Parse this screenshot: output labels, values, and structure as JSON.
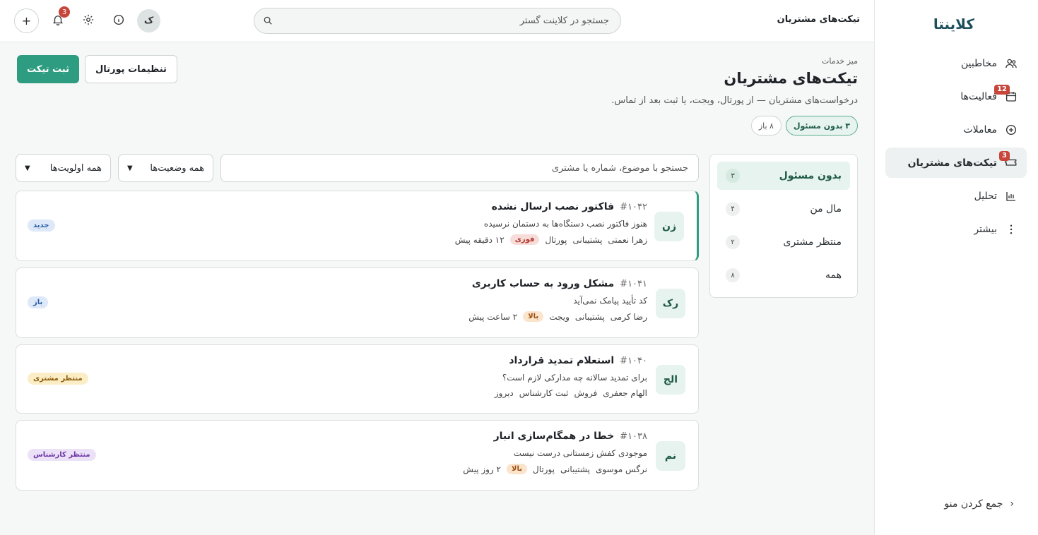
{
  "sidebar": {
    "brand": "کلاینتا",
    "items": [
      {
        "label": "مخاطبین",
        "icon": "users-icon",
        "badge": ""
      },
      {
        "label": "فعالیت‌ها",
        "icon": "calendar-icon",
        "badge": "12"
      },
      {
        "label": "معاملات",
        "icon": "plus-circle-icon",
        "badge": ""
      },
      {
        "label": "تیکت‌های مشتریان",
        "icon": "ticket-icon",
        "badge": "3"
      },
      {
        "label": "تحلیل",
        "icon": "chart-icon",
        "badge": ""
      },
      {
        "label": "بیشتر",
        "icon": "more-vertical-icon",
        "badge": ""
      }
    ],
    "collapse_label": "جمع کردن منو"
  },
  "topbar": {
    "title": "تیکت‌های مشتریان",
    "search_placeholder": "جستجو در کلاینت گستر",
    "notification_count": "3",
    "avatar_initial": "ک"
  },
  "page": {
    "breadcrumb": "میز خدمات",
    "title": "تیکت‌های مشتریان",
    "subtitle": "درخواست‌های مشتریان — از پورتال، ویجت، یا ثبت بعد از تماس.",
    "chip_unassigned": "۳ بدون مسئول",
    "chip_open": "۸ باز",
    "btn_new_ticket": "ثبت تیکت",
    "btn_portal_settings": "تنظیمات پورتال"
  },
  "views": [
    {
      "label": "بدون مسئول",
      "count": "۳"
    },
    {
      "label": "مال من",
      "count": "۴"
    },
    {
      "label": "منتظر مشتری",
      "count": "۲"
    },
    {
      "label": "همه",
      "count": "۸"
    }
  ],
  "filters": {
    "search_placeholder": "جستجو با موضوع، شماره یا مشتری",
    "status_select": "همه وضعیت‌ها",
    "priority_select": "همه اولویت‌ها"
  },
  "tickets": [
    {
      "initials": "زن",
      "id": "#۱۰۴۲",
      "title": "فاکتور نصب ارسال نشده",
      "desc": "هنوز فاکتور نصب دستگاه‌ها به دستمان نرسیده",
      "customer": "زهرا نعمتی",
      "team": "پشتیبانی",
      "channel": "پورتال",
      "priority": "فوری",
      "time": "۱۲ دقیقه پیش",
      "status": "جدید"
    },
    {
      "initials": "رک",
      "id": "#۱۰۴۱",
      "title": "مشکل ورود به حساب کاربری",
      "desc": "کد تأیید پیامک نمی‌آید",
      "customer": "رضا کرمی",
      "team": "پشتیبانی",
      "channel": "ویجت",
      "priority": "بالا",
      "time": "۲ ساعت پیش",
      "status": "باز"
    },
    {
      "initials": "الج",
      "id": "#۱۰۴۰",
      "title": "استعلام تمدید قرارداد",
      "desc": "برای تمدید سالانه چه مدارکی لازم است؟",
      "customer": "الهام جعفری",
      "team": "فروش",
      "channel": "ثبت کارشناس",
      "priority": "",
      "time": "دیروز",
      "status": "منتظر مشتری"
    },
    {
      "initials": "نم",
      "id": "#۱۰۳۸",
      "title": "خطا در همگام‌سازی انبار",
      "desc": "موجودی کفش زمستانی درست نیست",
      "customer": "نرگس موسوی",
      "team": "پشتیبانی",
      "channel": "پورتال",
      "priority": "بالا",
      "time": "۲ روز پیش",
      "status": "منتظر کارشناس"
    }
  ],
  "colors": {
    "accent": "#2e9c80",
    "brand": "#1e4f5c",
    "badge": "#c8453a"
  }
}
